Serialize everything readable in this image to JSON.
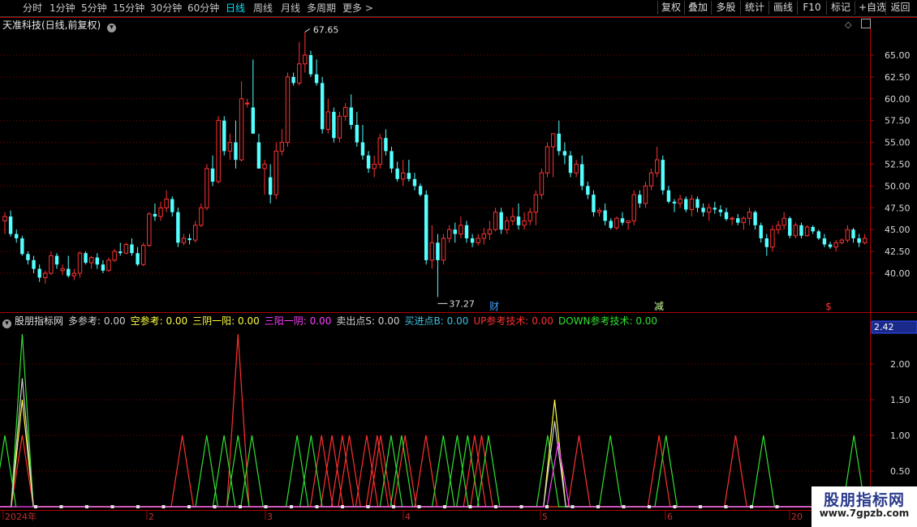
{
  "toolbar": {
    "period_tabs": [
      {
        "label": "分时",
        "active": false
      },
      {
        "label": "1分钟",
        "active": false
      },
      {
        "label": "5分钟",
        "active": false
      },
      {
        "label": "15分钟",
        "active": false
      },
      {
        "label": "30分钟",
        "active": false
      },
      {
        "label": "60分钟",
        "active": false
      },
      {
        "label": "日线",
        "active": true
      },
      {
        "label": "周线",
        "active": false
      },
      {
        "label": "月线",
        "active": false
      },
      {
        "label": "多周期",
        "active": false
      },
      {
        "label": "更多 >",
        "active": false
      }
    ],
    "right_buttons": [
      "复权",
      "叠加",
      "多股",
      "统计",
      "画线",
      "F10",
      "标记",
      "+自选",
      "返回"
    ]
  },
  "kline": {
    "title": "天准科技(日线,前复权)",
    "high_label": "67.65",
    "low_label": "37.27",
    "y_ticks": [
      "65.00",
      "62.50",
      "60.00",
      "57.50",
      "55.00",
      "52.50",
      "50.00",
      "47.50",
      "45.00",
      "42.50",
      "40.00"
    ],
    "markers": [
      {
        "text": "财",
        "color": "#3aa0ff"
      },
      {
        "text": "减",
        "color": "#c8ff9a"
      },
      {
        "text": "$",
        "color": "#ff3333"
      }
    ]
  },
  "indicator": {
    "name": "股朋指标网",
    "items": [
      {
        "label": "多参考: 0.00",
        "color": "#d0d0d0"
      },
      {
        "label": "空参考: 0.00",
        "color": "#ffff40"
      },
      {
        "label": "三阴一阳: 0.00",
        "color": "#ffff40"
      },
      {
        "label": "三阳一阴: 0.00",
        "color": "#ff40ff"
      },
      {
        "label": "卖出点S: 0.00",
        "color": "#d0d0d0"
      },
      {
        "label": "买进点B: 0.00",
        "color": "#40c0e0"
      },
      {
        "label": "UP参考技术: 0.00",
        "color": "#ff3030"
      },
      {
        "label": "DOWN参考技术: 0.00",
        "color": "#30e030"
      }
    ],
    "current_value": "2.42",
    "y_ticks": [
      "2.00",
      "1.50",
      "1.00",
      "0.50"
    ]
  },
  "time_axis": {
    "labels": [
      "2024年",
      "2",
      "3",
      "4",
      "5",
      "6",
      "20"
    ]
  },
  "watermark": {
    "line1": "股朋指标网",
    "line2": "www.7gpzb.com"
  },
  "colors": {
    "up": "#ff3232",
    "down": "#54ffff",
    "grid": "#8b0000",
    "axis": "#b00000"
  },
  "chart_data": {
    "type": "candlestick",
    "ylim": [
      38,
      68
    ],
    "candles": [
      [
        46.0,
        47.0,
        44.5,
        46.5
      ],
      [
        46.5,
        47.2,
        44.2,
        44.5
      ],
      [
        44.5,
        45.0,
        43.5,
        44.0
      ],
      [
        44.0,
        44.3,
        42.0,
        42.2
      ],
      [
        42.2,
        42.5,
        41.0,
        41.5
      ],
      [
        41.5,
        42.0,
        40.0,
        40.5
      ],
      [
        40.5,
        41.0,
        39.0,
        39.5
      ],
      [
        39.5,
        40.3,
        38.8,
        40.0
      ],
      [
        40.0,
        42.5,
        39.8,
        42.0
      ],
      [
        42.0,
        42.3,
        40.5,
        41.0
      ],
      [
        40.3,
        41.0,
        39.8,
        40.5
      ],
      [
        40.5,
        42.0,
        39.5,
        39.7
      ],
      [
        39.7,
        40.5,
        39.2,
        40.0
      ],
      [
        40.0,
        42.5,
        39.5,
        42.3
      ],
      [
        42.3,
        42.5,
        41.0,
        41.2
      ],
      [
        41.2,
        42.0,
        40.5,
        41.8
      ],
      [
        41.8,
        42.3,
        40.5,
        41.0
      ],
      [
        41.0,
        41.5,
        40.0,
        40.3
      ],
      [
        40.3,
        41.8,
        40.2,
        41.5
      ],
      [
        41.5,
        42.8,
        41.3,
        42.5
      ],
      [
        42.5,
        43.5,
        42.0,
        42.3
      ],
      [
        42.3,
        43.5,
        42.2,
        43.3
      ],
      [
        43.3,
        44.0,
        42.0,
        42.3
      ],
      [
        42.3,
        43.0,
        40.8,
        41.0
      ],
      [
        41.0,
        43.5,
        40.8,
        43.2
      ],
      [
        43.2,
        47.0,
        43.0,
        46.8
      ],
      [
        46.8,
        48.0,
        46.0,
        46.5
      ],
      [
        46.5,
        48.2,
        46.0,
        47.5
      ],
      [
        47.5,
        49.5,
        47.0,
        48.5
      ],
      [
        48.5,
        48.8,
        46.5,
        47.0
      ],
      [
        47.0,
        47.5,
        43.0,
        43.5
      ],
      [
        43.5,
        44.5,
        43.2,
        44.0
      ],
      [
        44.0,
        44.5,
        43.3,
        43.8
      ],
      [
        43.8,
        46.0,
        43.5,
        45.5
      ],
      [
        45.5,
        48.0,
        45.3,
        47.5
      ],
      [
        47.5,
        52.5,
        47.2,
        52.0
      ],
      [
        52.0,
        53.5,
        50.0,
        50.5
      ],
      [
        50.5,
        58.0,
        50.3,
        57.5
      ],
      [
        57.5,
        58.0,
        53.5,
        54.0
      ],
      [
        54.0,
        56.0,
        53.0,
        55.0
      ],
      [
        55.0,
        57.5,
        52.0,
        53.0
      ],
      [
        53.0,
        62.0,
        52.8,
        60.0
      ],
      [
        59.5,
        60.0,
        59.0,
        59.5
      ],
      [
        59.0,
        64.5,
        56.0,
        56.0
      ],
      [
        55.0,
        56.0,
        52.0,
        52.0
      ],
      [
        52.0,
        53.0,
        49.0,
        52.5
      ],
      [
        51.0,
        52.5,
        48.0,
        49.0
      ],
      [
        49.0,
        55.0,
        48.5,
        54.0
      ],
      [
        54.0,
        56.5,
        53.5,
        55.0
      ],
      [
        55.0,
        63.0,
        54.5,
        62.5
      ],
      [
        62.5,
        63.0,
        61.5,
        61.8
      ],
      [
        61.8,
        66.5,
        61.5,
        64.0
      ],
      [
        64.0,
        67.65,
        63.0,
        65.0
      ],
      [
        65.0,
        65.5,
        62.5,
        62.8
      ],
      [
        62.8,
        64.5,
        61.5,
        61.8
      ],
      [
        61.8,
        62.5,
        56.0,
        56.5
      ],
      [
        56.5,
        60.0,
        56.0,
        58.5
      ],
      [
        58.5,
        59.0,
        55.0,
        55.5
      ],
      [
        55.5,
        58.5,
        55.0,
        58.0
      ],
      [
        58.0,
        59.5,
        57.5,
        59.0
      ],
      [
        59.0,
        60.5,
        56.5,
        57.0
      ],
      [
        57.0,
        58.5,
        54.5,
        55.0
      ],
      [
        55.0,
        57.0,
        53.0,
        53.5
      ],
      [
        53.5,
        54.0,
        51.5,
        52.0
      ],
      [
        52.0,
        53.5,
        51.0,
        52.5
      ],
      [
        52.5,
        56.0,
        52.0,
        55.5
      ],
      [
        55.5,
        56.5,
        53.5,
        54.0
      ],
      [
        54.0,
        54.5,
        51.5,
        52.0
      ],
      [
        52.0,
        52.8,
        50.5,
        50.8
      ],
      [
        50.8,
        53.0,
        50.0,
        51.5
      ],
      [
        51.5,
        53.0,
        50.5,
        50.8
      ],
      [
        50.8,
        51.5,
        49.5,
        50.0
      ],
      [
        50.0,
        50.3,
        48.8,
        49.0
      ],
      [
        49.0,
        49.5,
        41.0,
        41.5
      ],
      [
        41.5,
        45.5,
        40.5,
        43.5
      ],
      [
        43.5,
        44.5,
        37.27,
        41.5
      ],
      [
        41.5,
        44.5,
        41.0,
        44.0
      ],
      [
        44.0,
        45.5,
        43.5,
        45.0
      ],
      [
        45.0,
        45.8,
        43.5,
        44.5
      ],
      [
        44.5,
        46.5,
        44.0,
        45.5
      ],
      [
        45.5,
        46.0,
        43.5,
        44.0
      ],
      [
        44.0,
        44.5,
        43.0,
        43.5
      ],
      [
        43.5,
        44.5,
        43.2,
        44.0
      ],
      [
        44.0,
        45.2,
        43.3,
        44.5
      ],
      [
        44.5,
        46.0,
        43.8,
        45.0
      ],
      [
        45.0,
        47.5,
        44.8,
        47.0
      ],
      [
        47.0,
        47.5,
        44.5,
        45.0
      ],
      [
        45.0,
        46.5,
        44.5,
        46.0
      ],
      [
        46.0,
        47.5,
        45.5,
        46.5
      ],
      [
        46.5,
        48.0,
        45.0,
        45.5
      ],
      [
        45.5,
        47.0,
        45.0,
        46.0
      ],
      [
        46.0,
        47.5,
        45.5,
        47.0
      ],
      [
        47.0,
        49.5,
        45.5,
        49.0
      ],
      [
        49.0,
        52.0,
        48.5,
        51.5
      ],
      [
        51.5,
        55.0,
        51.0,
        54.5
      ],
      [
        54.5,
        55.5,
        51.0,
        56.0
      ],
      [
        56.0,
        57.5,
        53.5,
        54.0
      ],
      [
        54.0,
        55.0,
        52.5,
        53.5
      ],
      [
        53.5,
        54.0,
        51.0,
        51.5
      ],
      [
        51.5,
        53.0,
        51.0,
        52.5
      ],
      [
        52.5,
        53.5,
        49.5,
        50.0
      ],
      [
        50.0,
        50.5,
        48.5,
        49.0
      ],
      [
        49.0,
        49.5,
        46.5,
        47.0
      ],
      [
        47.0,
        47.5,
        46.5,
        47.2
      ],
      [
        47.2,
        48.0,
        45.5,
        46.0
      ],
      [
        46.0,
        46.3,
        45.0,
        45.2
      ],
      [
        45.2,
        46.5,
        45.0,
        46.3
      ],
      [
        46.3,
        47.0,
        45.5,
        45.8
      ],
      [
        45.8,
        46.0,
        45.0,
        46.0
      ],
      [
        46.0,
        49.5,
        45.5,
        49.0
      ],
      [
        49.0,
        49.5,
        47.5,
        48.0
      ],
      [
        48.0,
        50.5,
        47.5,
        50.0
      ],
      [
        50.0,
        52.0,
        49.5,
        51.5
      ],
      [
        51.5,
        54.5,
        51.0,
        53.0
      ],
      [
        53.0,
        53.5,
        49.0,
        49.5
      ],
      [
        49.5,
        50.0,
        48.0,
        48.2
      ],
      [
        48.2,
        48.5,
        47.0,
        48.0
      ],
      [
        48.0,
        49.0,
        47.5,
        48.5
      ],
      [
        48.5,
        48.8,
        47.0,
        47.3
      ],
      [
        47.3,
        49.0,
        46.5,
        48.5
      ],
      [
        48.5,
        48.8,
        47.0,
        47.5
      ],
      [
        47.5,
        48.0,
        46.5,
        47.0
      ],
      [
        47.0,
        48.0,
        46.0,
        47.5
      ],
      [
        47.5,
        48.2,
        46.8,
        47.3
      ],
      [
        47.3,
        47.8,
        46.5,
        47.0
      ],
      [
        47.0,
        47.5,
        46.0,
        46.2
      ],
      [
        46.2,
        46.5,
        45.5,
        46.3
      ],
      [
        46.3,
        46.8,
        45.5,
        45.8
      ],
      [
        45.8,
        46.5,
        45.0,
        46.3
      ],
      [
        46.3,
        47.5,
        45.5,
        47.0
      ],
      [
        47.0,
        47.2,
        45.0,
        45.5
      ],
      [
        45.5,
        45.8,
        43.5,
        44.0
      ],
      [
        44.0,
        44.5,
        42.0,
        43.0
      ],
      [
        43.0,
        45.5,
        42.5,
        45.0
      ],
      [
        45.0,
        46.0,
        44.5,
        45.5
      ],
      [
        45.5,
        47.0,
        45.0,
        46.3
      ],
      [
        46.3,
        46.5,
        44.0,
        44.3
      ],
      [
        44.3,
        45.8,
        44.0,
        45.5
      ],
      [
        45.5,
        45.8,
        44.0,
        44.3
      ],
      [
        44.3,
        45.5,
        44.2,
        45.3
      ],
      [
        45.3,
        45.5,
        44.5,
        44.8
      ],
      [
        44.8,
        45.0,
        43.8,
        44.0
      ],
      [
        44.0,
        44.5,
        43.0,
        43.3
      ],
      [
        43.3,
        43.6,
        42.8,
        43.0
      ],
      [
        43.0,
        43.8,
        42.5,
        43.5
      ],
      [
        43.5,
        44.0,
        43.3,
        43.8
      ],
      [
        43.8,
        45.5,
        43.5,
        45.0
      ],
      [
        45.0,
        45.2,
        43.5,
        44.0
      ],
      [
        44.0,
        44.5,
        43.0,
        43.5
      ],
      [
        43.5,
        44.5,
        43.3,
        44.0
      ]
    ],
    "indicator_ylim": [
      0,
      2.6
    ],
    "indicator_series": [
      {
        "name": "UP参考技术",
        "color": "#ff3030",
        "peaks": [
          [
            5,
            1
          ],
          [
            51,
            1
          ],
          [
            67,
            2.42
          ],
          [
            91,
            1
          ],
          [
            94,
            1
          ],
          [
            97,
            1
          ],
          [
            99,
            1
          ],
          [
            104,
            1
          ],
          [
            107,
            1
          ],
          [
            108,
            1
          ],
          [
            115,
            1
          ],
          [
            121,
            1
          ],
          [
            135,
            1
          ],
          [
            137,
            1
          ],
          [
            165,
            1
          ],
          [
            188,
            1
          ],
          [
            210,
            1
          ]
        ]
      },
      {
        "name": "DOWN参考技术",
        "color": "#30e030",
        "peaks": [
          [
            0,
            1
          ],
          [
            5,
            2.42
          ],
          [
            58,
            1
          ],
          [
            63,
            1
          ],
          [
            67,
            1
          ],
          [
            71,
            1
          ],
          [
            84,
            1
          ],
          [
            88,
            1
          ],
          [
            111,
            1
          ],
          [
            114,
            1
          ],
          [
            126,
            1
          ],
          [
            130,
            1
          ],
          [
            133,
            1
          ],
          [
            139,
            1
          ],
          [
            156,
            1
          ],
          [
            174,
            1
          ],
          [
            190,
            1
          ],
          [
            218,
            1
          ],
          [
            244,
            1
          ]
        ]
      },
      {
        "name": "三阴一阳",
        "color": "#ffff40",
        "peaks": [
          [
            5,
            1.5
          ],
          [
            158,
            1.5
          ]
        ]
      },
      {
        "name": "多参考",
        "color": "#d0d0d0",
        "peaks": [
          [
            5,
            1.8
          ],
          [
            158,
            1.2
          ]
        ]
      },
      {
        "name": "三阳一阴",
        "color": "#ff40ff",
        "peaks": [
          [
            159,
            0.9
          ]
        ]
      }
    ]
  }
}
